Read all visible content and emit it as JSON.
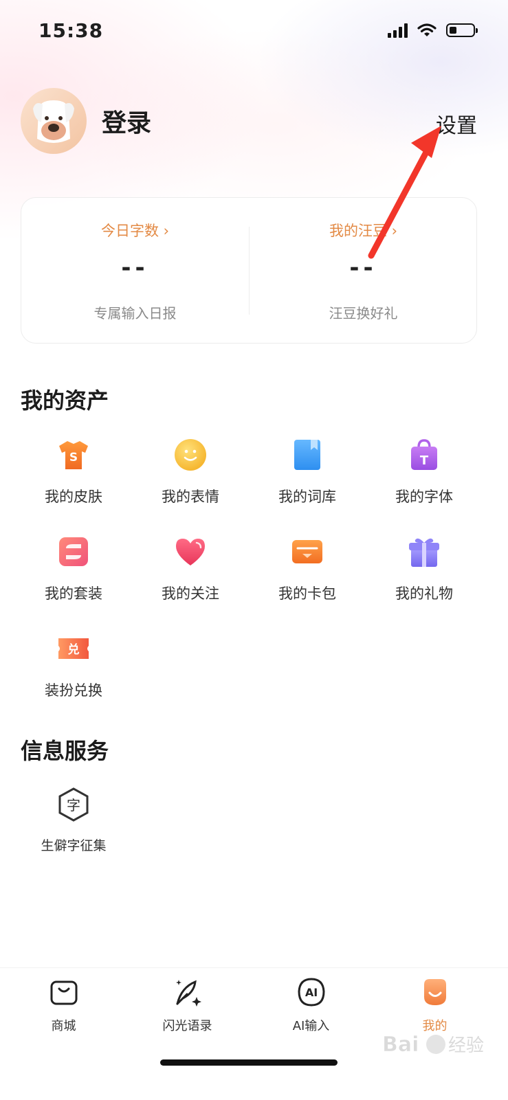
{
  "status_bar": {
    "time": "15:38",
    "battery_level": 0.3
  },
  "profile": {
    "login_label": "登录",
    "settings_label": "设置"
  },
  "stats": {
    "left": {
      "title": "今日字数 ›",
      "value": "--",
      "subtitle": "专属输入日报"
    },
    "right": {
      "title": "我的汪豆 ›",
      "value": "--",
      "subtitle": "汪豆换好礼"
    }
  },
  "assets": {
    "title": "我的资产",
    "items": [
      {
        "label": "我的皮肤",
        "icon": "shirt-icon"
      },
      {
        "label": "我的表情",
        "icon": "emoji-face-icon"
      },
      {
        "label": "我的词库",
        "icon": "book-icon"
      },
      {
        "label": "我的字体",
        "icon": "font-bag-icon"
      },
      {
        "label": "我的套装",
        "icon": "suit-icon"
      },
      {
        "label": "我的关注",
        "icon": "heart-icon"
      },
      {
        "label": "我的卡包",
        "icon": "card-wallet-icon"
      },
      {
        "label": "我的礼物",
        "icon": "gift-icon"
      },
      {
        "label": "装扮兑换",
        "icon": "exchange-ticket-icon"
      }
    ]
  },
  "services": {
    "title": "信息服务",
    "items": [
      {
        "label": "生僻字征集",
        "icon": "rare-character-icon"
      }
    ]
  },
  "tab_bar": {
    "items": [
      {
        "label": "商城",
        "icon": "shop-bag-icon"
      },
      {
        "label": "闪光语录",
        "icon": "quill-sparkle-icon"
      },
      {
        "label": "AI输入",
        "icon": "ai-input-icon"
      },
      {
        "label": "我的",
        "icon": "profile-dog-icon",
        "active": true
      }
    ]
  },
  "watermark": "Baidu 经验",
  "colors": {
    "accent": "#e38a45",
    "annotation_arrow": "#f2362a"
  }
}
